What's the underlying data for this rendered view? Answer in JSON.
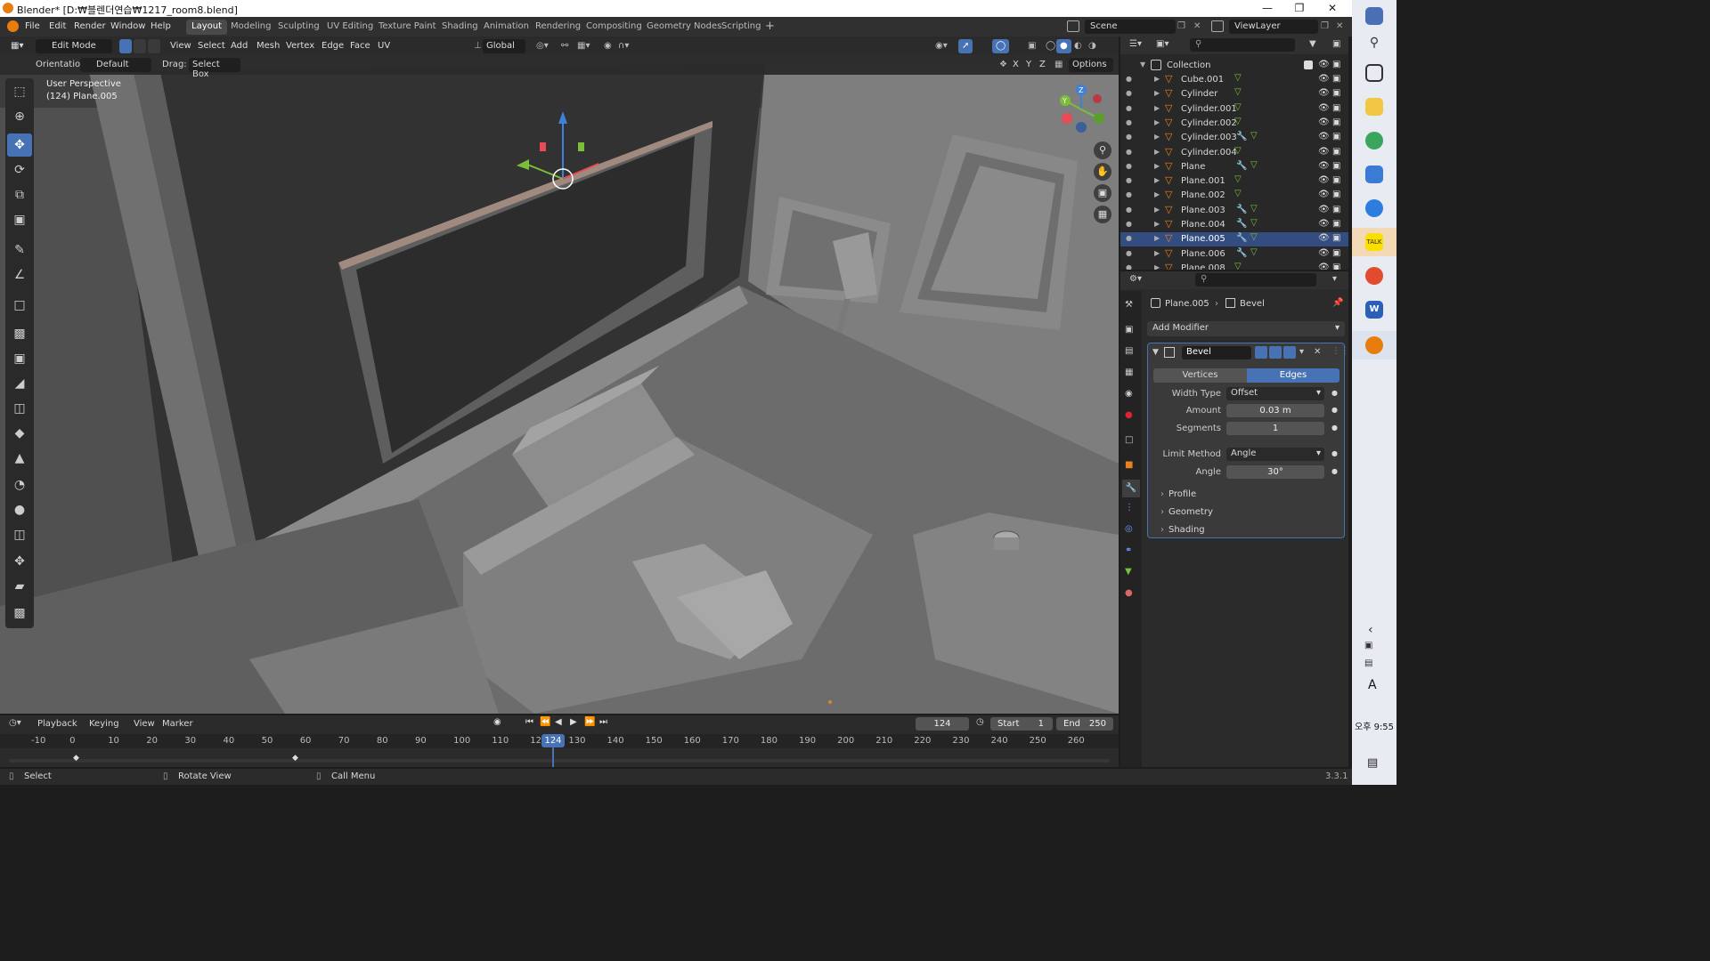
{
  "window": {
    "title": "Blender* [D:₩블렌더연습₩1217_room8.blend]",
    "min_icon": "minimize-icon",
    "max_icon": "restore-icon",
    "close_icon": "close-icon"
  },
  "menubar": {
    "items": [
      "File",
      "Edit",
      "Render",
      "Window",
      "Help"
    ],
    "workspaces": [
      "Layout",
      "Modeling",
      "Sculpting",
      "UV Editing",
      "Texture Paint",
      "Shading",
      "Animation",
      "Rendering",
      "Compositing",
      "Geometry Nodes",
      "Scripting"
    ],
    "active_workspace": "Layout",
    "add_tab": "+",
    "scene_label": "Scene",
    "viewlayer_label": "ViewLayer"
  },
  "viewport_header": {
    "mode": "Edit Mode",
    "menus": [
      "View",
      "Select",
      "Add",
      "Mesh",
      "Vertex",
      "Edge",
      "Face",
      "UV"
    ],
    "transform_orientation": "Global",
    "orientation_label": "Orientation:",
    "orientation_value": "Default",
    "drag_label": "Drag:",
    "drag_value": "Select Box",
    "axis_labels": [
      "X",
      "Y",
      "Z"
    ],
    "options_label": "Options"
  },
  "viewport": {
    "perspective": "User Perspective",
    "object_info": "(124) Plane.005",
    "gizmo_axes": [
      "X",
      "Y",
      "Z"
    ]
  },
  "toolbar": {
    "tools": [
      "select-box-icon",
      "cursor-icon",
      "move-icon",
      "rotate-icon",
      "scale-icon",
      "transform-icon",
      "annotate-icon",
      "measure-icon",
      "add-cube-icon",
      "extrude-icon",
      "inset-icon",
      "bevel-icon",
      "loop-cut-icon",
      "knife-icon",
      "poly-build-icon",
      "spin-icon",
      "smooth-icon",
      "edge-slide-icon",
      "shrink-fatten-icon",
      "shear-icon",
      "rip-icon"
    ],
    "active_index": 2
  },
  "outliner": {
    "root": "Collection",
    "items": [
      {
        "name": "Cube.001",
        "modifier": false,
        "selected": false
      },
      {
        "name": "Cylinder",
        "modifier": false,
        "selected": false
      },
      {
        "name": "Cylinder.001",
        "modifier": false,
        "selected": false
      },
      {
        "name": "Cylinder.002",
        "modifier": false,
        "selected": false
      },
      {
        "name": "Cylinder.003",
        "modifier": true,
        "selected": false
      },
      {
        "name": "Cylinder.004",
        "modifier": false,
        "selected": false
      },
      {
        "name": "Plane",
        "modifier": true,
        "selected": false
      },
      {
        "name": "Plane.001",
        "modifier": false,
        "selected": false
      },
      {
        "name": "Plane.002",
        "modifier": false,
        "selected": false
      },
      {
        "name": "Plane.003",
        "modifier": true,
        "selected": false
      },
      {
        "name": "Plane.004",
        "modifier": true,
        "selected": false
      },
      {
        "name": "Plane.005",
        "modifier": true,
        "selected": true
      },
      {
        "name": "Plane.006",
        "modifier": true,
        "selected": false
      },
      {
        "name": "Plane.008",
        "modifier": false,
        "selected": false
      }
    ]
  },
  "properties": {
    "breadcrumb_object": "Plane.005",
    "breadcrumb_modifier": "Bevel",
    "add_modifier": "Add Modifier",
    "modifier_name": "Bevel",
    "affect_options": [
      "Vertices",
      "Edges"
    ],
    "affect_selected": "Edges",
    "width_type_label": "Width Type",
    "width_type_value": "Offset",
    "amount_label": "Amount",
    "amount_value": "0.03 m",
    "segments_label": "Segments",
    "segments_value": "1",
    "limit_method_label": "Limit Method",
    "limit_method_value": "Angle",
    "angle_label": "Angle",
    "angle_value": "30°",
    "panels": [
      "Profile",
      "Geometry",
      "Shading"
    ]
  },
  "timeline": {
    "menus": [
      "Playback",
      "Keying",
      "View",
      "Marker"
    ],
    "current_frame": "124",
    "start_label": "Start",
    "start_value": "1",
    "end_label": "End",
    "end_value": "250",
    "ruler": [
      "-10",
      "0",
      "10",
      "20",
      "30",
      "40",
      "50",
      "60",
      "70",
      "80",
      "90",
      "100",
      "110",
      "120",
      "130",
      "140",
      "150",
      "160",
      "170",
      "180",
      "190",
      "200",
      "210",
      "220",
      "230",
      "240",
      "250",
      "260"
    ]
  },
  "statusbar": {
    "select": "Select",
    "rotate": "Rotate View",
    "call_menu": "Call Menu",
    "version": "3.3.1"
  },
  "taskbar": {
    "clock": "오후 9:55",
    "ime": "A",
    "colors": {
      "blender": "#e87d0d",
      "accent": "#4772b3",
      "selection": "#334d80"
    }
  }
}
